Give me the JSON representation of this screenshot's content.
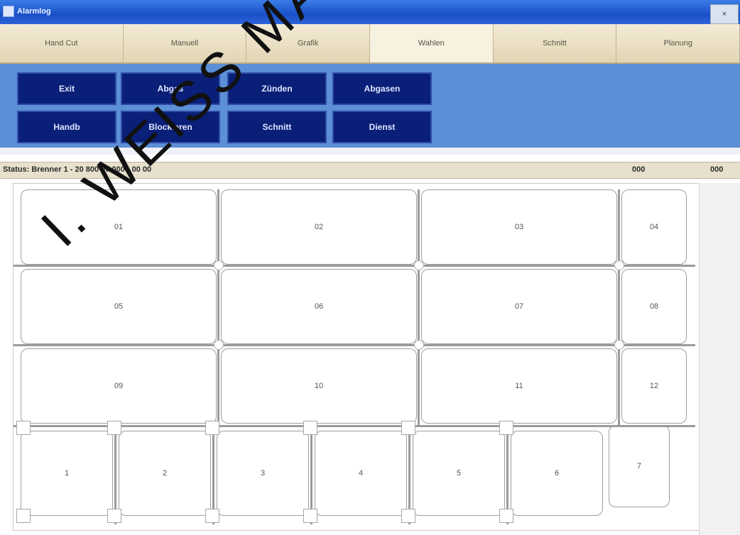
{
  "window": {
    "title": "Alarmlog"
  },
  "tabs": [
    "Hand Cut",
    "Manuell",
    "Grafik",
    "Wahlen",
    "Schnitt",
    "Planung"
  ],
  "toolbar": {
    "row1": [
      "Exit",
      "Abgas",
      "Zünden",
      "Abgasen"
    ],
    "row2": [
      "Handb",
      "Blockieren",
      "Schnitt",
      "Dienst"
    ]
  },
  "status": {
    "text": "Status: Brenner 1 - 20 800 00 000 - 00 00",
    "val1": "000",
    "val2": "000"
  },
  "grid": {
    "big_labels": [
      "01",
      "02",
      "03",
      "04",
      "05",
      "06",
      "07",
      "08",
      "09",
      "10",
      "11",
      "12"
    ],
    "bottom_labels": [
      "1",
      "2",
      "3",
      "4",
      "5",
      "6",
      "7"
    ]
  },
  "watermark": "I. WEISS MACHINE"
}
